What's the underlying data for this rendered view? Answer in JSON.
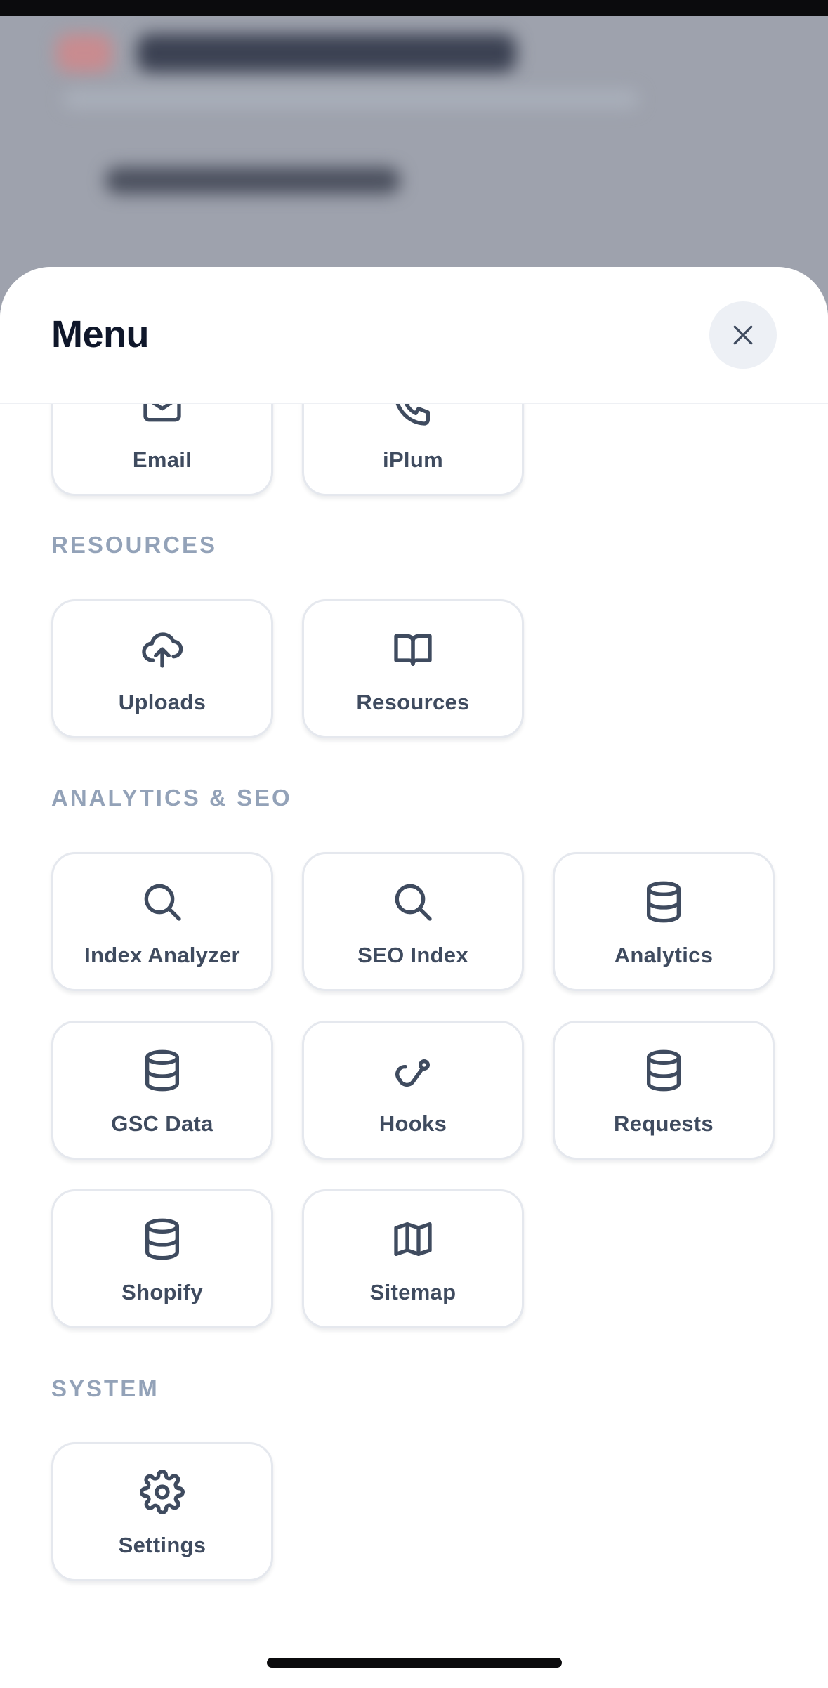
{
  "menu": {
    "title": "Menu",
    "close_icon": "close-icon"
  },
  "partial_items": [
    {
      "label": "Email",
      "icon": "mail-icon"
    },
    {
      "label": "iPlum",
      "icon": "phone-icon"
    }
  ],
  "sections": {
    "resources": {
      "title": "RESOURCES",
      "items": [
        {
          "label": "Uploads",
          "icon": "cloud-upload-icon"
        },
        {
          "label": "Resources",
          "icon": "book-open-icon"
        }
      ]
    },
    "analytics": {
      "title": "ANALYTICS & SEO",
      "items": [
        {
          "label": "Index Analyzer",
          "icon": "search-icon"
        },
        {
          "label": "SEO Index",
          "icon": "search-icon"
        },
        {
          "label": "Analytics",
          "icon": "database-icon"
        },
        {
          "label": "GSC Data",
          "icon": "database-icon"
        },
        {
          "label": "Hooks",
          "icon": "webhook-icon"
        },
        {
          "label": "Requests",
          "icon": "database-icon"
        },
        {
          "label": "Shopify",
          "icon": "database-icon"
        },
        {
          "label": "Sitemap",
          "icon": "map-icon"
        }
      ]
    },
    "system": {
      "title": "SYSTEM",
      "items": [
        {
          "label": "Settings",
          "icon": "gear-icon"
        }
      ]
    }
  },
  "colors": {
    "icon_stroke": "#3f4b5f",
    "section_title": "#93a2b8",
    "title": "#0f172a",
    "tile_border": "#e5e8ee",
    "backdrop": "#9ea2ad"
  }
}
